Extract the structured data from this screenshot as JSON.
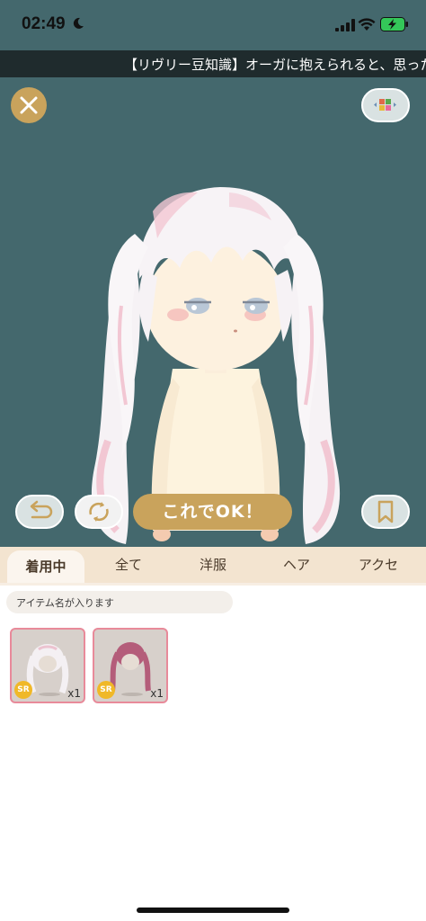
{
  "status_bar": {
    "time": "02:49"
  },
  "ticker": {
    "text": "【リヴリー豆知識】オーガに抱えられると、思った"
  },
  "controls": {
    "ok_label": "これでOK！"
  },
  "tabs": [
    {
      "label": "着用中",
      "active": true
    },
    {
      "label": "全て"
    },
    {
      "label": "洋服"
    },
    {
      "label": "ヘア"
    },
    {
      "label": "アクセ"
    }
  ],
  "item_name_placeholder": "アイテム名が入ります",
  "items": [
    {
      "rarity": "SR",
      "quantity": "x1",
      "hair_color": "white"
    },
    {
      "rarity": "SR",
      "quantity": "x1",
      "hair_color": "pink"
    }
  ],
  "colors": {
    "stage_bg": "#44686d",
    "accent_gold": "#c9a35c",
    "tab_bar": "#f3e4d0",
    "card_border": "#e88a9a",
    "rarity_badge": "#f0b828"
  }
}
